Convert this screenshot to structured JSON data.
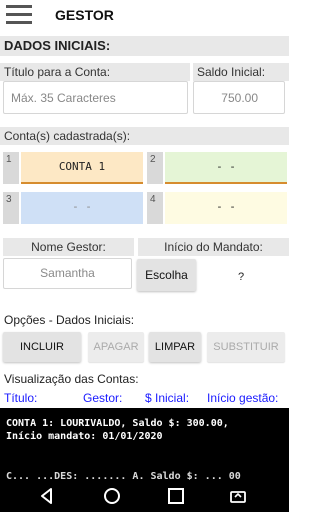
{
  "appbar": {
    "title": "GESTOR",
    "menu_icon": "hamburger-menu-icon"
  },
  "section": {
    "title": "DADOS INICIAIS:"
  },
  "account": {
    "title_label": "Título para a Conta:",
    "title_placeholder": "Máx. 35 Caracteres",
    "balance_label": "Saldo Inicial:",
    "balance_placeholder": "750.00"
  },
  "slots": {
    "label": "Conta(s) cadastrada(s):",
    "items": [
      {
        "number": "1",
        "text": "CONTA 1",
        "color": "#fde8c5"
      },
      {
        "number": "2",
        "text": "- -",
        "color": "#e5f5d6"
      },
      {
        "number": "3",
        "text": "- -",
        "color": "#cfe0f6"
      },
      {
        "number": "4",
        "text": "- -",
        "color": "#fefbe2"
      }
    ]
  },
  "manager": {
    "name_label": "Nome Gestor:",
    "name_placeholder": "Samantha",
    "mandate_label": "Início do Mandato:",
    "choose_button": "Escolha",
    "mandate_value": "?"
  },
  "options": {
    "label": "Opções - Dados Iniciais:",
    "buttons": [
      {
        "label": "INCLUIR",
        "enabled": true
      },
      {
        "label": "APAGAR",
        "enabled": false
      },
      {
        "label": "LIMPAR",
        "enabled": true
      },
      {
        "label": "SUBSTITUIR",
        "enabled": false
      }
    ]
  },
  "view": {
    "label": "Visualização das Contas:",
    "columns": [
      "Título:",
      "Gestor:",
      "$ Inicial:",
      "Início gestão:"
    ],
    "console_lines": [
      "CONTA 1: LOURIVALDO, Saldo $: 300.00,",
      "Início mandato: 01/01/2020",
      "C... ...DES: ....... A. Saldo $: ... 00"
    ]
  },
  "navbar": {
    "icons": [
      "back-icon",
      "home-icon",
      "recents-icon",
      "rotate-icon"
    ]
  },
  "colors": {
    "accent_text": "#1a1aff",
    "slot_underline": "#d68c2e"
  }
}
